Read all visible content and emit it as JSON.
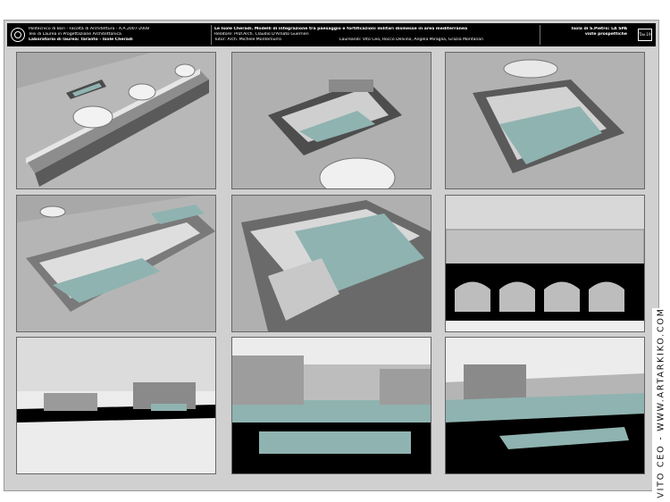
{
  "header": {
    "left_lines": [
      "Politecnico di Bari - Facoltà di Architettura - A.A.2007-2008",
      "Tesi di Laurea in Progettazione Architettonica",
      "Laboratorio di laurea: Taranto - Isole Cheradi"
    ],
    "center_lines": [
      "Le Isole Cheradi. Modelli di integrazione tra paesaggio e fortificazioni militari dismesse in area mediterranea",
      "Relatore: Prof.Arch. Claudio D'Amato Guerrieri",
      "Tutor: Arch. Michele Montemurro"
    ],
    "center_right_line": "Laureandi: Vito Ceo, Rocco Delvino, Angela Miraglia, Grazia Montanari",
    "right_lines": [
      "Isola di S.Pietro: LA SPA",
      "viste prospettiche"
    ],
    "tav_label": "Tav.19"
  },
  "credit": "VITO CEO - WWW.ARTARKIKO.COM",
  "colors": {
    "water": "#8fb3b0",
    "header_bg": "#000000",
    "sheet_bg": "#d0d0d0"
  }
}
